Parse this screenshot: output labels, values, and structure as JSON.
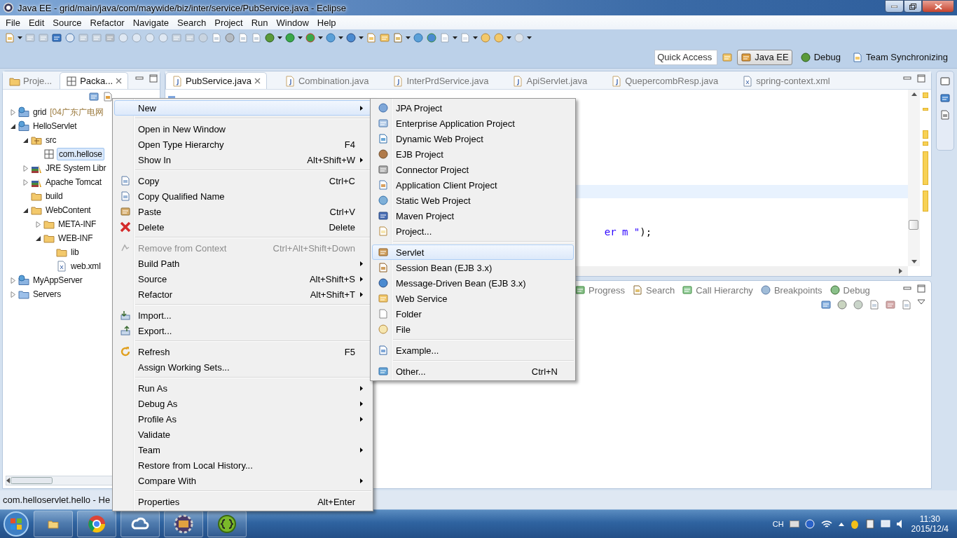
{
  "window": {
    "title": "Java EE - grid/main/java/com/maywide/biz/inter/service/PubService.java - Eclipse"
  },
  "menubar": [
    {
      "label": "File"
    },
    {
      "label": "Edit"
    },
    {
      "label": "Source"
    },
    {
      "label": "Refactor"
    },
    {
      "label": "Navigate"
    },
    {
      "label": "Search"
    },
    {
      "label": "Project"
    },
    {
      "label": "Run"
    },
    {
      "label": "Window"
    },
    {
      "label": "Help"
    }
  ],
  "quick_access": {
    "placeholder": "Quick Access"
  },
  "perspectives": [
    {
      "label": "Java EE",
      "selected": true
    },
    {
      "label": "Debug",
      "selected": false
    },
    {
      "label": "Team Synchronizing",
      "selected": false
    }
  ],
  "left_panel": {
    "tabs": [
      {
        "label": "Proje...",
        "selected": false
      },
      {
        "label": "Packa...",
        "selected": true
      }
    ],
    "tree": [
      {
        "kind": "project",
        "label": "grid",
        "decoration": "[04广东广电网",
        "expanded": false,
        "selected": false
      },
      {
        "kind": "project",
        "label": "HelloServlet",
        "expanded": true,
        "selected": false,
        "children": [
          {
            "kind": "source",
            "label": "src",
            "expanded": true,
            "selected": false,
            "children": [
              {
                "kind": "package",
                "label": "com.hellose",
                "selected": true
              }
            ]
          },
          {
            "kind": "library",
            "label": "JRE System Libr",
            "expanded": false,
            "selected": false
          },
          {
            "kind": "library",
            "label": "Apache Tomcat",
            "expanded": false,
            "selected": false
          },
          {
            "kind": "folder",
            "label": "build",
            "selected": false
          },
          {
            "kind": "folder",
            "label": "WebContent",
            "expanded": true,
            "selected": false,
            "children": [
              {
                "kind": "folder",
                "label": "META-INF",
                "expanded": false,
                "selected": false
              },
              {
                "kind": "folder",
                "label": "WEB-INF",
                "expanded": true,
                "selected": false,
                "children": [
                  {
                    "kind": "folder",
                    "label": "lib",
                    "selected": false
                  },
                  {
                    "kind": "xml",
                    "label": "web.xml",
                    "selected": false
                  }
                ]
              }
            ]
          }
        ]
      },
      {
        "kind": "project",
        "label": "MyAppServer",
        "expanded": false,
        "selected": false
      },
      {
        "kind": "servers",
        "label": "Servers",
        "expanded": false,
        "selected": false
      }
    ]
  },
  "editor": {
    "tabs": [
      {
        "label": "PubService.java",
        "selected": true
      },
      {
        "label": "Combination.java",
        "selected": false
      },
      {
        "label": "InterPrdService.java",
        "selected": false
      },
      {
        "label": "ApiServlet.java",
        "selected": false
      },
      {
        "label": "QuepercombResp.java",
        "selected": false
      },
      {
        "label": "spring-context.xml",
        "selected": false
      }
    ],
    "lines": [
      {
        "current": false
      },
      {
        "current": false
      },
      {
        "current": false
      },
      {
        "current": false
      },
      {
        "current": false
      },
      {
        "current": false
      },
      {
        "current": false
      },
      {
        "current": true
      },
      {
        "current": false
      },
      {
        "current": false
      },
      {
        "current": false,
        "tokens": [
          {
            "kind": "string",
            "text": "er m \""
          },
          {
            "kind": "plain",
            "text": ");"
          }
        ]
      }
    ]
  },
  "bottom_panel": {
    "tabs": [
      {
        "label": "Progress",
        "selected": false
      },
      {
        "label": "Search",
        "selected": false
      },
      {
        "label": "Call Hierarchy",
        "selected": false
      },
      {
        "label": "Breakpoints",
        "selected": false
      },
      {
        "label": "Debug",
        "selected": false
      }
    ]
  },
  "status_bar": {
    "text": "com.helloservlet.hello - He"
  },
  "context_menu": [
    {
      "kind": "item",
      "label": "New",
      "submenu": true,
      "selected": true
    },
    {
      "kind": "separator"
    },
    {
      "kind": "item",
      "label": "Open in New Window",
      "selected": false
    },
    {
      "kind": "item",
      "label": "Open Type Hierarchy",
      "shortcut": "F4",
      "selected": false
    },
    {
      "kind": "item",
      "label": "Show In",
      "shortcut": "Alt+Shift+W",
      "submenu": true,
      "selected": false
    },
    {
      "kind": "separator"
    },
    {
      "kind": "item",
      "label": "Copy",
      "shortcut": "Ctrl+C",
      "icon": true,
      "selected": false
    },
    {
      "kind": "item",
      "label": "Copy Qualified Name",
      "icon": true,
      "selected": false
    },
    {
      "kind": "item",
      "label": "Paste",
      "shortcut": "Ctrl+V",
      "icon": true,
      "selected": false
    },
    {
      "kind": "item",
      "label": "Delete",
      "shortcut": "Delete",
      "icon": true,
      "selected": false
    },
    {
      "kind": "separator"
    },
    {
      "kind": "item",
      "label": "Remove from Context",
      "shortcut": "Ctrl+Alt+Shift+Down",
      "icon": true,
      "disabled": true,
      "selected": false
    },
    {
      "kind": "item",
      "label": "Build Path",
      "submenu": true,
      "selected": false
    },
    {
      "kind": "item",
      "label": "Source",
      "shortcut": "Alt+Shift+S",
      "submenu": true,
      "selected": false
    },
    {
      "kind": "item",
      "label": "Refactor",
      "shortcut": "Alt+Shift+T",
      "submenu": true,
      "selected": false
    },
    {
      "kind": "separator"
    },
    {
      "kind": "item",
      "label": "Import...",
      "icon": true,
      "selected": false
    },
    {
      "kind": "item",
      "label": "Export...",
      "icon": true,
      "selected": false
    },
    {
      "kind": "separator"
    },
    {
      "kind": "item",
      "label": "Refresh",
      "shortcut": "F5",
      "icon": true,
      "selected": false
    },
    {
      "kind": "item",
      "label": "Assign Working Sets...",
      "selected": false
    },
    {
      "kind": "separator"
    },
    {
      "kind": "item",
      "label": "Run As",
      "submenu": true,
      "selected": false
    },
    {
      "kind": "item",
      "label": "Debug As",
      "submenu": true,
      "selected": false
    },
    {
      "kind": "item",
      "label": "Profile As",
      "submenu": true,
      "selected": false
    },
    {
      "kind": "item",
      "label": "Validate",
      "selected": false
    },
    {
      "kind": "item",
      "label": "Team",
      "submenu": true,
      "selected": false
    },
    {
      "kind": "item",
      "label": "Restore from Local History...",
      "selected": false
    },
    {
      "kind": "item",
      "label": "Compare With",
      "submenu": true,
      "selected": false
    },
    {
      "kind": "separator"
    },
    {
      "kind": "item",
      "label": "Properties",
      "shortcut": "Alt+Enter",
      "selected": false
    }
  ],
  "new_submenu": [
    {
      "kind": "item",
      "label": "JPA Project",
      "selected": false
    },
    {
      "kind": "item",
      "label": "Enterprise Application Project",
      "selected": false
    },
    {
      "kind": "item",
      "label": "Dynamic Web Project",
      "selected": false
    },
    {
      "kind": "item",
      "label": "EJB Project",
      "selected": false
    },
    {
      "kind": "item",
      "label": "Connector Project",
      "selected": false
    },
    {
      "kind": "item",
      "label": "Application Client Project",
      "selected": false
    },
    {
      "kind": "item",
      "label": "Static Web Project",
      "selected": false
    },
    {
      "kind": "item",
      "label": "Maven Project",
      "selected": false
    },
    {
      "kind": "item",
      "label": "Project...",
      "selected": false
    },
    {
      "kind": "separator"
    },
    {
      "kind": "item",
      "label": "Servlet",
      "selected": true
    },
    {
      "kind": "item",
      "label": "Session Bean (EJB 3.x)",
      "selected": false
    },
    {
      "kind": "item",
      "label": "Message-Driven Bean (EJB 3.x)",
      "selected": false
    },
    {
      "kind": "item",
      "label": "Web Service",
      "selected": false
    },
    {
      "kind": "item",
      "label": "Folder",
      "selected": false
    },
    {
      "kind": "item",
      "label": "File",
      "selected": false
    },
    {
      "kind": "separator"
    },
    {
      "kind": "item",
      "label": "Example...",
      "selected": false
    },
    {
      "kind": "separator"
    },
    {
      "kind": "item",
      "label": "Other...",
      "shortcut": "Ctrl+N",
      "selected": false
    }
  ],
  "taskbar": {
    "tray": {
      "language": "CH",
      "time": "11:30",
      "date": "2015/12/4"
    }
  }
}
